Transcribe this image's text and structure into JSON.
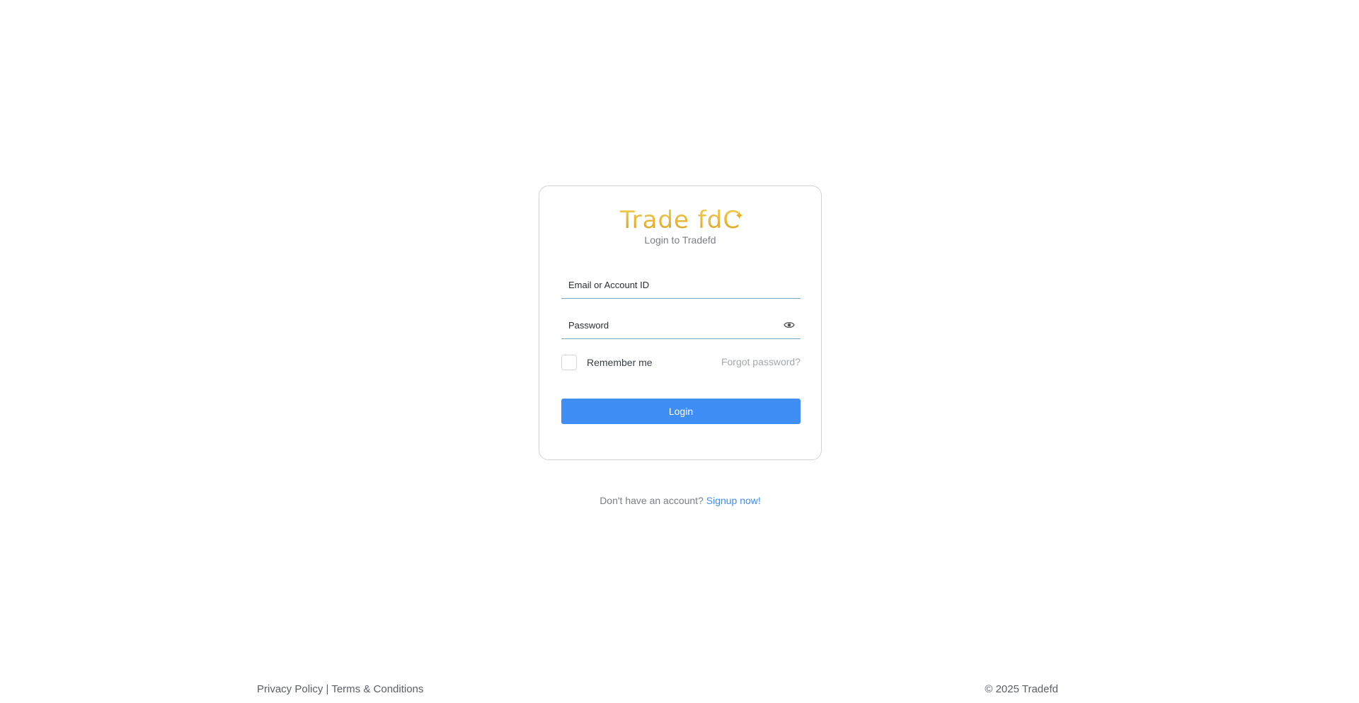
{
  "brand": {
    "logo_text": "Trade fd",
    "logo_accent": "C",
    "logo_color": "#e7b53a"
  },
  "login": {
    "subtitle": "Login to Tradefd",
    "email_placeholder": "Email or Account ID",
    "password_placeholder": "Password",
    "remember_label": "Remember me",
    "forgot_label": "Forgot password?",
    "submit_label": "Login"
  },
  "signup": {
    "prompt": "Don't have an account?",
    "link_label": "Signup now!"
  },
  "footer": {
    "privacy_label": "Privacy Policy",
    "separator": "|",
    "terms_label": "Terms & Conditions",
    "copyright": "© 2025 Tradefd"
  },
  "colors": {
    "accent": "#3e8ef5",
    "input_underline": "#7aa6c6"
  },
  "icons": {
    "password_toggle": "eye-icon"
  }
}
